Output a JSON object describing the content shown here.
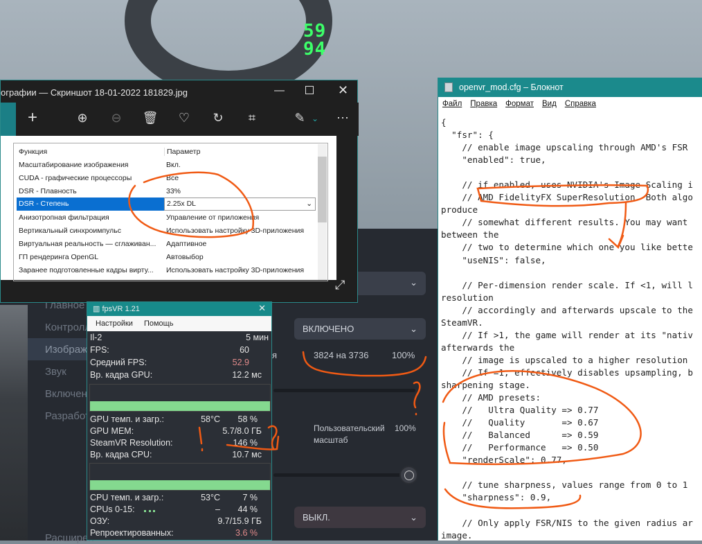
{
  "hud": {
    "line1": "59",
    "line2": "94"
  },
  "steamvr": {
    "sidebar": [
      "Главное",
      "Контролл",
      "Изображе",
      "Звук",
      "Включен",
      "Разработ",
      "Расширен"
    ],
    "dropdown_enabled": "ВКЛЮЧЕНО",
    "resolution_label_tail": "я",
    "resolution": "3824 на 3736",
    "resolution_pct": "100%",
    "custom_scale_label_1": "Пользовательский",
    "custom_scale_label_2": "масштаб",
    "custom_scale_pct": "100%",
    "dropdown_off": "ВЫКЛ."
  },
  "photos": {
    "title": "ографии — Скриншот 18-01-2022 181829.jpg",
    "table": {
      "headers": [
        "Функция",
        "Параметр"
      ],
      "rows": [
        [
          "Масштабирование изображения",
          "Вкл."
        ],
        [
          "CUDA - графические процессоры",
          "Все"
        ],
        [
          "DSR - Плавность",
          "33%"
        ],
        [
          "DSR - Степень",
          "2.25x DL"
        ],
        [
          "Анизотропная фильтрация",
          "Управление от приложения"
        ],
        [
          "Вертикальный синхроимпульс",
          "Использовать настройку 3D-приложения"
        ],
        [
          "Виртуальная реальность — сглаживан...",
          "Адаптивное"
        ],
        [
          "ГП рендеринга OpenGL",
          "Автовыбор"
        ],
        [
          "Заранее подготовленные кадры вирту...",
          "Использовать настройку 3D-приложения"
        ]
      ]
    }
  },
  "fpsvr": {
    "title": "fpsVR 1.21",
    "menu": [
      "Настройки",
      "Помощь"
    ],
    "rows1": [
      {
        "l": "Il-2",
        "m": "",
        "r": "5 мин"
      },
      {
        "l": "FPS:",
        "m": "",
        "r": "60"
      },
      {
        "l": "Средний FPS:",
        "m": "",
        "r": "52.9"
      },
      {
        "l": "Вр. кадра GPU:",
        "m": "",
        "r": "12.2 мс"
      }
    ],
    "rows2": [
      {
        "l": "GPU темп. и загр.:",
        "m": "58°C",
        "r": "58 %"
      },
      {
        "l": "GPU MEM:",
        "m": "",
        "r": "5.7/8.0 ГБ"
      },
      {
        "l": "SteamVR Resolution:",
        "m": "",
        "r": "146 %"
      },
      {
        "l": "Вр. кадра CPU:",
        "m": "",
        "r": "10.7 мс"
      }
    ],
    "rows3": [
      {
        "l": "CPU темп. и загр.:",
        "m": "53°C",
        "r": "7 %"
      },
      {
        "l": "CPUs 0-15:",
        "m": "–",
        "r": "44 %"
      },
      {
        "l": "ОЗУ:",
        "m": "",
        "r": "9.7/15.9 ГБ"
      },
      {
        "l": "Репроектированных:",
        "m": "",
        "r": "3.6 %"
      }
    ],
    "accent": "#e07a7a"
  },
  "notepad": {
    "title": "openvr_mod.cfg – Блокнот",
    "menu": [
      "Файл",
      "Правка",
      "Формат",
      "Вид",
      "Справка"
    ],
    "text": "{\n  \"fsr\": {\n    // enable image upscaling through AMD's FSR\n    \"enabled\": true,\n\n    // if enabled, uses NVIDIA's Image Scaling i\n    // AMD FidelityFX SuperResolution. Both algo\nproduce\n    // somewhat different results. You may want\nbetween the\n    // two to determine which one you like bette\n    \"useNIS\": false,\n\n    // Per-dimension render scale. If <1, will l\nresolution\n    // accordingly and afterwards upscale to the\nSteamVR.\n    // If >1, the game will render at its \"nativ\nafterwards the\n    // image is upscaled to a higher resolution\n    // If =1, effectively disables upsampling, b\nsharpening stage.\n    // AMD presets:\n    //   Ultra Quality => 0.77\n    //   Quality       => 0.67\n    //   Balanced      => 0.59\n    //   Performance   => 0.50\n    \"renderScale\": 0.77,\n\n    // tune sharpness, values range from 0 to 1\n    \"sharpness\": 0.9,\n\n    // Only apply FSR/NIS to the given radius ar\nimage."
  },
  "annotations": {
    "color": "#f05a14",
    "marks": [
      "!",
      "?",
      "?",
      "?"
    ]
  }
}
